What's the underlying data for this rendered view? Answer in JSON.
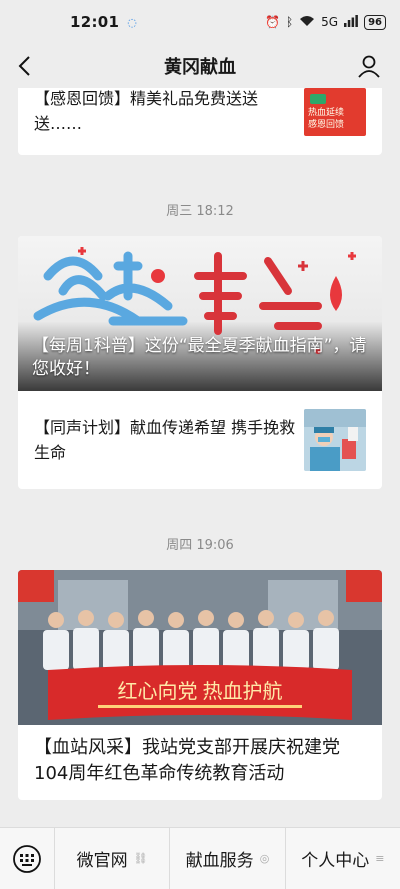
{
  "status": {
    "time": "12:01",
    "signal": "5G",
    "battery": "96"
  },
  "nav": {
    "title": "黄冈献血"
  },
  "top_card": {
    "text": "【感恩回馈】精美礼品免费送送送……",
    "thumb_text_1": "热血延续",
    "thumb_text_2": "感恩回馈"
  },
  "group1": {
    "time": "周三 18:12",
    "hero_caption": "【每周1科普】这份“最全夏季献血指南”，请您收好！",
    "item_text": "【同声计划】献血传递希望 携手挽救生命"
  },
  "group2": {
    "time": "周四 19:06",
    "banner_text": "红心向党 热血护航",
    "title": "【血站风采】我站党支部开展庆祝建党104周年红色革命传统教育活动"
  },
  "menu": {
    "items": [
      "微官网",
      "献血服务",
      "个人中心"
    ]
  },
  "colors": {
    "accent": "#c8102e",
    "sky": "#6fb7e8"
  }
}
